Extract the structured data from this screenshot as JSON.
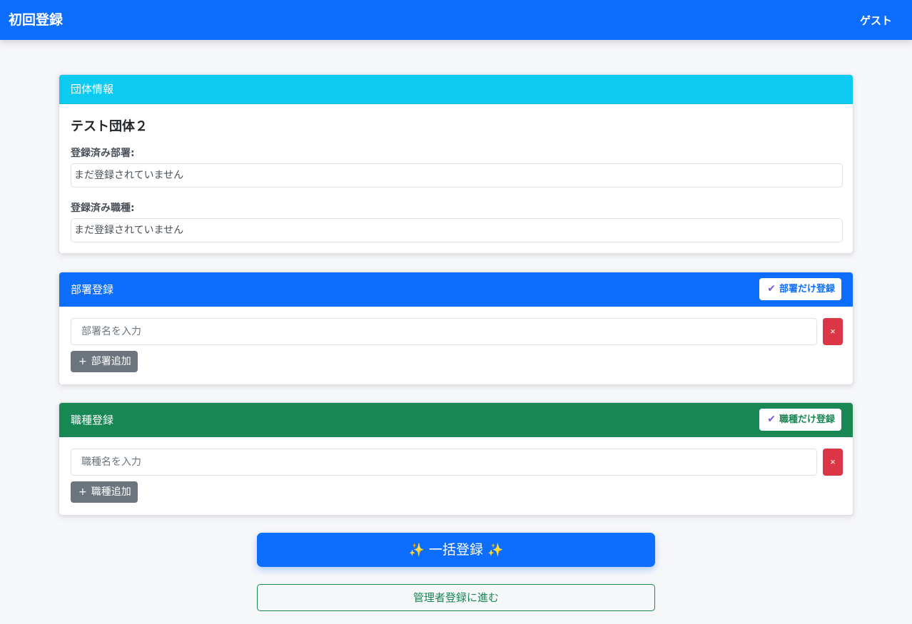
{
  "navbar": {
    "title": "初回登録",
    "user": "ゲスト"
  },
  "organization": {
    "header": "団体情報",
    "name": "テスト団体２",
    "departments_label": "登録済み部署:",
    "departments_value": "まだ登録されていません",
    "jobs_label": "登録済み職種:",
    "jobs_value": "まだ登録されていません"
  },
  "department": {
    "header": "部署登録",
    "only_button": "部署だけ登録",
    "input_placeholder": "部署名を入力",
    "remove_symbol": "×",
    "add_symbol": "+",
    "add_button": "部署追加"
  },
  "job": {
    "header": "職種登録",
    "only_button": "職種だけ登録",
    "input_placeholder": "職種名を入力",
    "remove_symbol": "×",
    "add_symbol": "+",
    "add_button": "職種追加"
  },
  "actions": {
    "bulk_register": "一括登録",
    "admin_register": "管理者登録に進む"
  },
  "icons": {
    "check": "check-icon",
    "sparkle": "sparkle-icon"
  },
  "colors": {
    "primary": "#0d6efd",
    "info": "#0dcaf0",
    "success": "#198754",
    "danger": "#dc3545",
    "secondary": "#6c757d"
  }
}
